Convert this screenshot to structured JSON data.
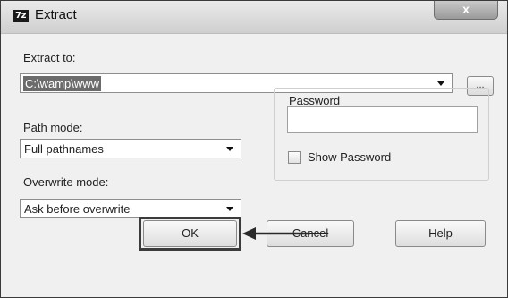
{
  "window": {
    "title": "Extract",
    "app_icon_text": "7z",
    "close_glyph": "x"
  },
  "extract_to": {
    "label": "Extract to:",
    "value": "C:\\wamp\\www",
    "browse_label": "..."
  },
  "path_mode": {
    "label": "Path mode:",
    "selected": "Full pathnames"
  },
  "overwrite_mode": {
    "label": "Overwrite mode:",
    "selected": "Ask before overwrite"
  },
  "password": {
    "group_label": "Password",
    "value": "",
    "show_password_label": "Show Password",
    "show_password_checked": false
  },
  "buttons": {
    "ok": "OK",
    "cancel": "Cancel",
    "help": "Help"
  },
  "annotation": {
    "arrow_color": "#2a2a2a",
    "highlight_target": "ok-button"
  }
}
